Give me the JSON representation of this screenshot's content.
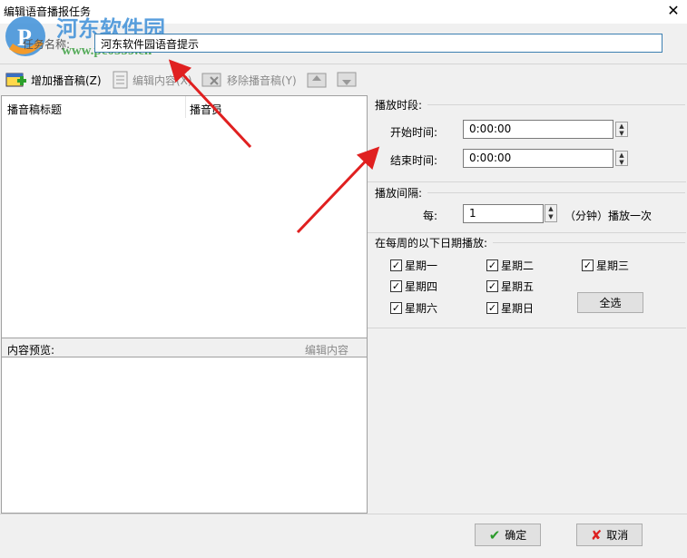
{
  "window": {
    "title": "编辑语音播报任务",
    "close": "✕"
  },
  "task": {
    "label": "任务名称:",
    "value": "河东软件园语音提示"
  },
  "watermark": {
    "name": "河东软件园",
    "url": "www.pc0359.cn"
  },
  "toolbar": {
    "add": "增加播音稿(Z)",
    "edit": "编辑内容(X)",
    "remove": "移除播音稿(Y)"
  },
  "list": {
    "columns": [
      "播音稿标题",
      "播音员"
    ]
  },
  "preview": {
    "label": "内容预览:",
    "edit": "编辑内容"
  },
  "period": {
    "title": "播放时段:",
    "start_label": "开始时间:",
    "start": "0:00:00",
    "end_label": "结束时间:",
    "end": "0:00:00"
  },
  "interval": {
    "title": "播放间隔:",
    "every": "每:",
    "value": "1",
    "unit": "（分钟）播放一次"
  },
  "days": {
    "title": "在每周的以下日期播放:",
    "items": [
      {
        "label": "星期一",
        "checked": true
      },
      {
        "label": "星期二",
        "checked": true
      },
      {
        "label": "星期三",
        "checked": true
      },
      {
        "label": "星期四",
        "checked": true
      },
      {
        "label": "星期五",
        "checked": true
      },
      {
        "label": "星期六",
        "checked": true
      },
      {
        "label": "星期日",
        "checked": true
      }
    ],
    "select_all": "全选"
  },
  "footer": {
    "ok": "确定",
    "cancel": "取消"
  }
}
